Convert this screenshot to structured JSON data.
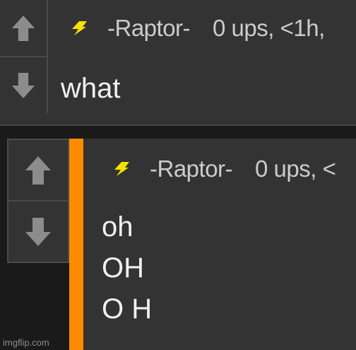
{
  "comments": [
    {
      "author": "-Raptor-",
      "meta": "0 ups, <1h,",
      "flair_icon": "lightning-icon",
      "lines": [
        "what"
      ]
    },
    {
      "author": "-Raptor-",
      "meta": "0 ups, <",
      "flair_icon": "lightning-icon",
      "lines": [
        "oh",
        "OH",
        "O H"
      ]
    }
  ],
  "icons": {
    "upvote": "arrow-up-icon",
    "downvote": "arrow-down-icon"
  },
  "colors": {
    "background": "#1a1a1a",
    "comment_bg": "#333333",
    "reply_highlight": "#ff8c00",
    "flair": "#f5e200",
    "arrow": "#8c8c8c"
  },
  "watermark": "imgflip.com"
}
